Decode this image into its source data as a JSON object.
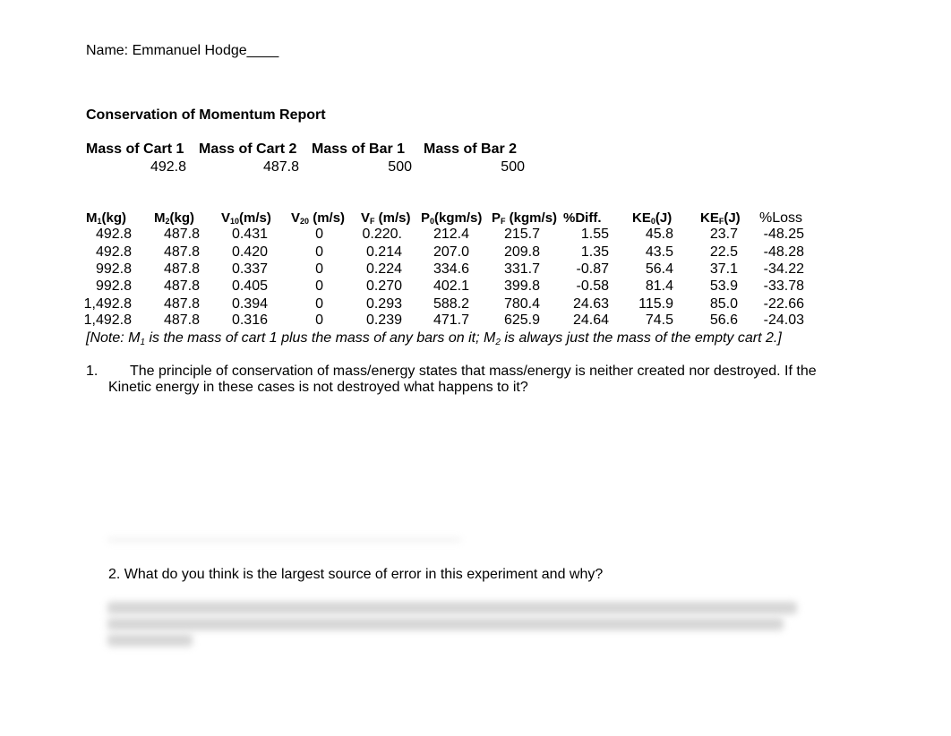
{
  "header": {
    "name_line": "Name: Emmanuel Hodge____",
    "report_title": "Conservation of Momentum Report"
  },
  "masses": {
    "headers": [
      "Mass of Cart 1",
      "Mass of Cart 2",
      "Mass of Bar 1",
      "Mass of Bar 2"
    ],
    "values": [
      "492.8",
      "487.8",
      "500",
      "500"
    ]
  },
  "table": {
    "columns": [
      {
        "main": "M",
        "sub": "1",
        "unit": "(kg)"
      },
      {
        "main": "M",
        "sub": "2",
        "unit": "(kg)"
      },
      {
        "main": "V",
        "sub": "10",
        "unit": "(m/s)"
      },
      {
        "main": "V",
        "sub": "20",
        "unit": " (m/s)"
      },
      {
        "main": "V",
        "sub": "F",
        "unit": " (m/s)"
      },
      {
        "main": "P",
        "sub": "0",
        "unit": "(kgm/s)"
      },
      {
        "main": "P",
        "sub": "F",
        "unit": " (kgm/s)"
      },
      {
        "main": "%Diff.",
        "sub": "",
        "unit": ""
      },
      {
        "main": "KE",
        "sub": "0",
        "unit": "(J)"
      },
      {
        "main": "KE",
        "sub": "F",
        "unit": "(J)"
      },
      {
        "main": "%Loss",
        "sub": "",
        "unit": ""
      }
    ],
    "rows": [
      [
        "492.8",
        "487.8",
        "0.431",
        "0",
        "0.220.",
        "212.4",
        "215.7",
        "1.55",
        "45.8",
        "23.7",
        "-48.25"
      ],
      [
        "492.8",
        "487.8",
        "0.420",
        "0",
        "0.214",
        "207.0",
        "209.8",
        "1.35",
        "43.5",
        "22.5",
        "-48.28"
      ],
      [
        "992.8",
        "487.8",
        "0.337",
        "0",
        "0.224",
        "334.6",
        "331.7",
        "-0.87",
        "56.4",
        "37.1",
        "-34.22"
      ],
      [
        "992.8",
        "487.8",
        "0.405",
        "0",
        "0.270",
        "402.1",
        "399.8",
        "-0.58",
        "81.4",
        "53.9",
        "-33.78"
      ],
      [
        "1,492.8",
        "487.8",
        "0.394",
        "0",
        "0.293",
        "588.2",
        "780.4",
        "24.63",
        "115.9",
        "85.0",
        "-22.66"
      ],
      [
        "1,492.8",
        "487.8",
        "0.316",
        "0",
        "0.239",
        "471.7",
        "625.9",
        "24.64",
        "74.5",
        "56.6",
        "-24.03"
      ]
    ]
  },
  "note": {
    "part1": "[Note: M",
    "sub1": "1",
    "part2": " is the mass of cart 1 plus the mass of any bars on it; M",
    "sub2": "2",
    "part3": " is always just the mass of the empty cart 2.]"
  },
  "questions": [
    {
      "number": "1.",
      "line1": "The principle of conservation of mass/energy states that mass/energy is neither created nor destroyed.  If the",
      "line2": "Kinetic energy in these cases is not destroyed what happens to it?"
    },
    {
      "number": "2.",
      "text": "2.  What do you think is the largest source of error in this experiment and why?"
    }
  ]
}
